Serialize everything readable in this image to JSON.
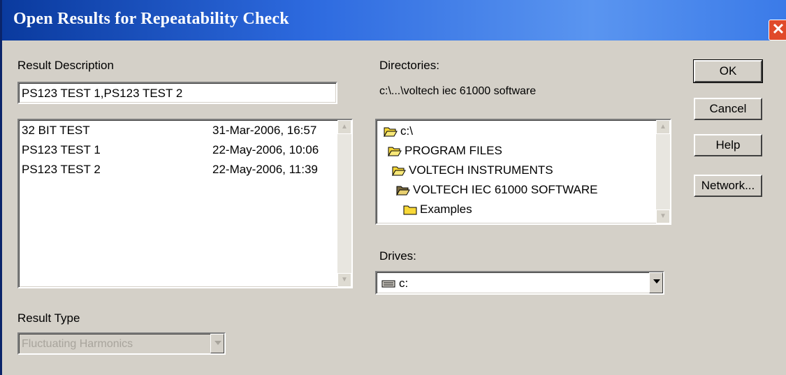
{
  "window": {
    "title": "Open Results for Repeatability Check",
    "close_glyph": "✕"
  },
  "result_description": {
    "label": "Result Description",
    "value": "PS123 TEST 1,PS123 TEST 2"
  },
  "results_list": {
    "items": [
      {
        "name": "32 BIT TEST",
        "date": "31-Mar-2006, 16:57"
      },
      {
        "name": "PS123 TEST 1",
        "date": "22-May-2006, 10:06"
      },
      {
        "name": "PS123 TEST 2",
        "date": "22-May-2006, 11:39"
      }
    ]
  },
  "result_type": {
    "label": "Result Type",
    "value": "Fluctuating Harmonics"
  },
  "directories": {
    "label": "Directories:",
    "current_path": "c:\\...\\voltech iec 61000 software",
    "tree": [
      {
        "name": "c:\\",
        "icon": "open-folder-icon"
      },
      {
        "name": "PROGRAM FILES",
        "icon": "open-folder-icon"
      },
      {
        "name": "VOLTECH INSTRUMENTS",
        "icon": "open-folder-icon"
      },
      {
        "name": "VOLTECH IEC 61000 SOFTWARE",
        "icon": "open-folder-icon"
      },
      {
        "name": "Examples",
        "icon": "closed-folder-icon"
      }
    ]
  },
  "drives": {
    "label": "Drives:",
    "value": "c:",
    "icon": "drive-icon"
  },
  "buttons": {
    "ok": "OK",
    "cancel": "Cancel",
    "help": "Help",
    "network": "Network..."
  },
  "colors": {
    "titlebar_start": "#0a3a9e",
    "titlebar_end": "#5a95f0",
    "dialog_face": "#d4d0c8",
    "close_button": "#e04a2a",
    "folder_yellow": "#f8d838"
  }
}
